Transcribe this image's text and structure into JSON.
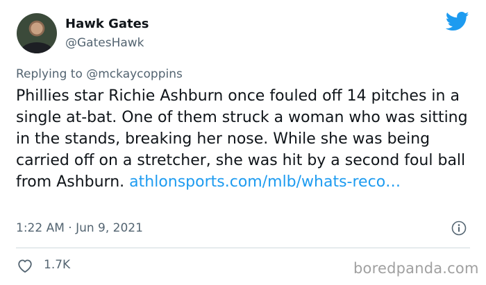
{
  "author": {
    "display_name": "Hawk Gates",
    "handle": "@GatesHawk"
  },
  "reply": {
    "prefix": "Replying to",
    "mention": "@mckaycoppins"
  },
  "tweet": {
    "text": "Phillies star Richie Ashburn once fouled off 14 pitches in a single at-bat. One of them struck a woman who was sitting in the stands, breaking her nose. While she was being carried off on a stretcher, she was hit by a second foul ball from Ashburn. ",
    "link_text": "athlonsports.com/mlb/whats-reco…"
  },
  "meta": {
    "timestamp": "1:22 AM · Jun 9, 2021"
  },
  "actions": {
    "like_count": "1.7K"
  },
  "watermark": "boredpanda.com",
  "icons": {
    "brand": "twitter-bird-icon",
    "info": "info-icon",
    "like": "heart-icon"
  },
  "colors": {
    "link": "#1d9bf0",
    "secondary_text": "#536471",
    "divider": "#cfd9de"
  }
}
